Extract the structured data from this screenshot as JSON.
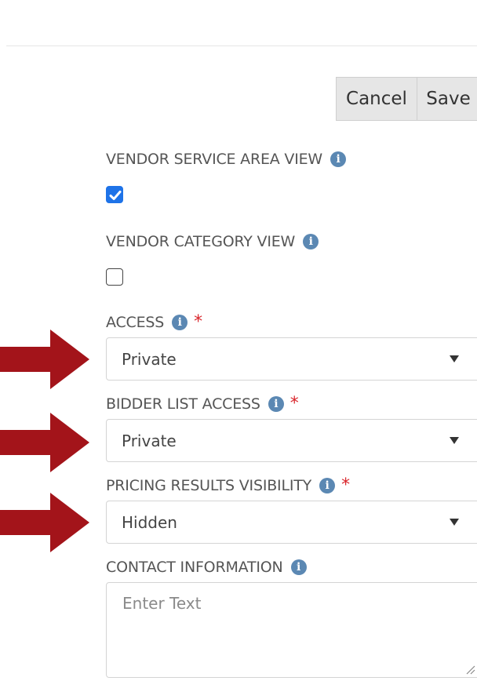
{
  "toolbar": {
    "cancel_label": "Cancel",
    "save_label": "Save"
  },
  "fields": {
    "vendor_service_area_view": {
      "label": "VENDOR SERVICE AREA VIEW",
      "checked": true
    },
    "vendor_category_view": {
      "label": "VENDOR CATEGORY VIEW",
      "checked": false
    },
    "access": {
      "label": "ACCESS",
      "required_mark": "*",
      "value": "Private"
    },
    "bidder_list_access": {
      "label": "BIDDER LIST ACCESS",
      "required_mark": "*",
      "value": "Private"
    },
    "pricing_results_visibility": {
      "label": "PRICING RESULTS VISIBILITY",
      "required_mark": "*",
      "value": "Hidden"
    },
    "contact_information": {
      "label": "CONTACT INFORMATION",
      "placeholder": "Enter Text",
      "value": ""
    }
  },
  "icons": {
    "info": "info-icon",
    "info_glyph": "i",
    "dropdown": "caret-down-icon",
    "annotation_arrow": "red-arrow-icon"
  },
  "colors": {
    "info_icon": "#5b88b3",
    "required": "#d9262c",
    "checkbox_checked": "#1e73e8",
    "arrow": "#a3141a",
    "button_bg": "#e6e6e6"
  }
}
